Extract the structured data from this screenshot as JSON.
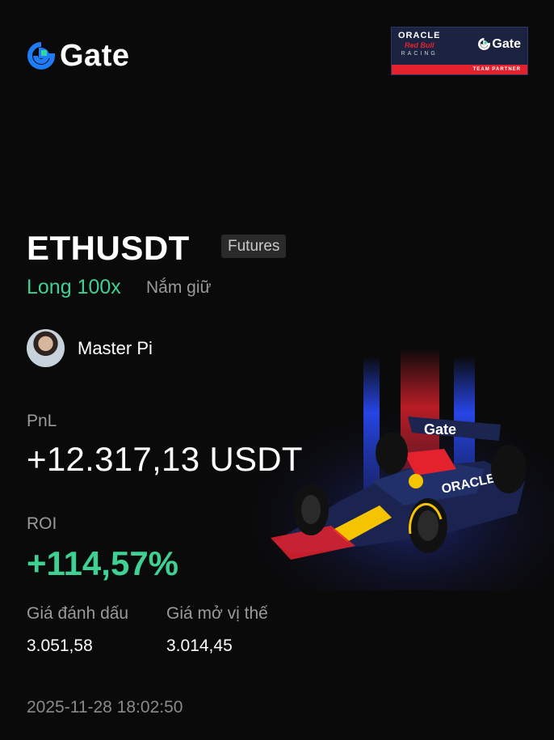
{
  "brand": {
    "name": "Gate",
    "accent": "#1f7cf6",
    "secondary": "#2fd6a4"
  },
  "partner": {
    "oracle": "ORACLE",
    "red_bull": "Red Bull",
    "racing": "RACING",
    "gate": "Gate",
    "team_partner": "TEAM PARTNER"
  },
  "position": {
    "symbol": "ETHUSDT",
    "market_badge": "Futures",
    "side": "Long 100x",
    "status": "Nắm giữ"
  },
  "user": {
    "name": "Master Pi",
    "avatar_icon": "user-avatar"
  },
  "pnl": {
    "label": "PnL",
    "value": "+12.317,13 USDT"
  },
  "roi": {
    "label": "ROI",
    "value": "+114,57%"
  },
  "prices": {
    "mark_label": "Giá đánh dấu",
    "mark_value": "3.051,58",
    "open_label": "Giá mở vị thế",
    "open_value": "3.014,45"
  },
  "timestamp": "2025-11-28 18:02:50",
  "car_livery": {
    "wing_text": "Gate",
    "sidepod_text": "ORACLE"
  },
  "colors": {
    "positive": "#3ed193",
    "muted": "#9a9a9a",
    "background": "#0a0a0a"
  }
}
